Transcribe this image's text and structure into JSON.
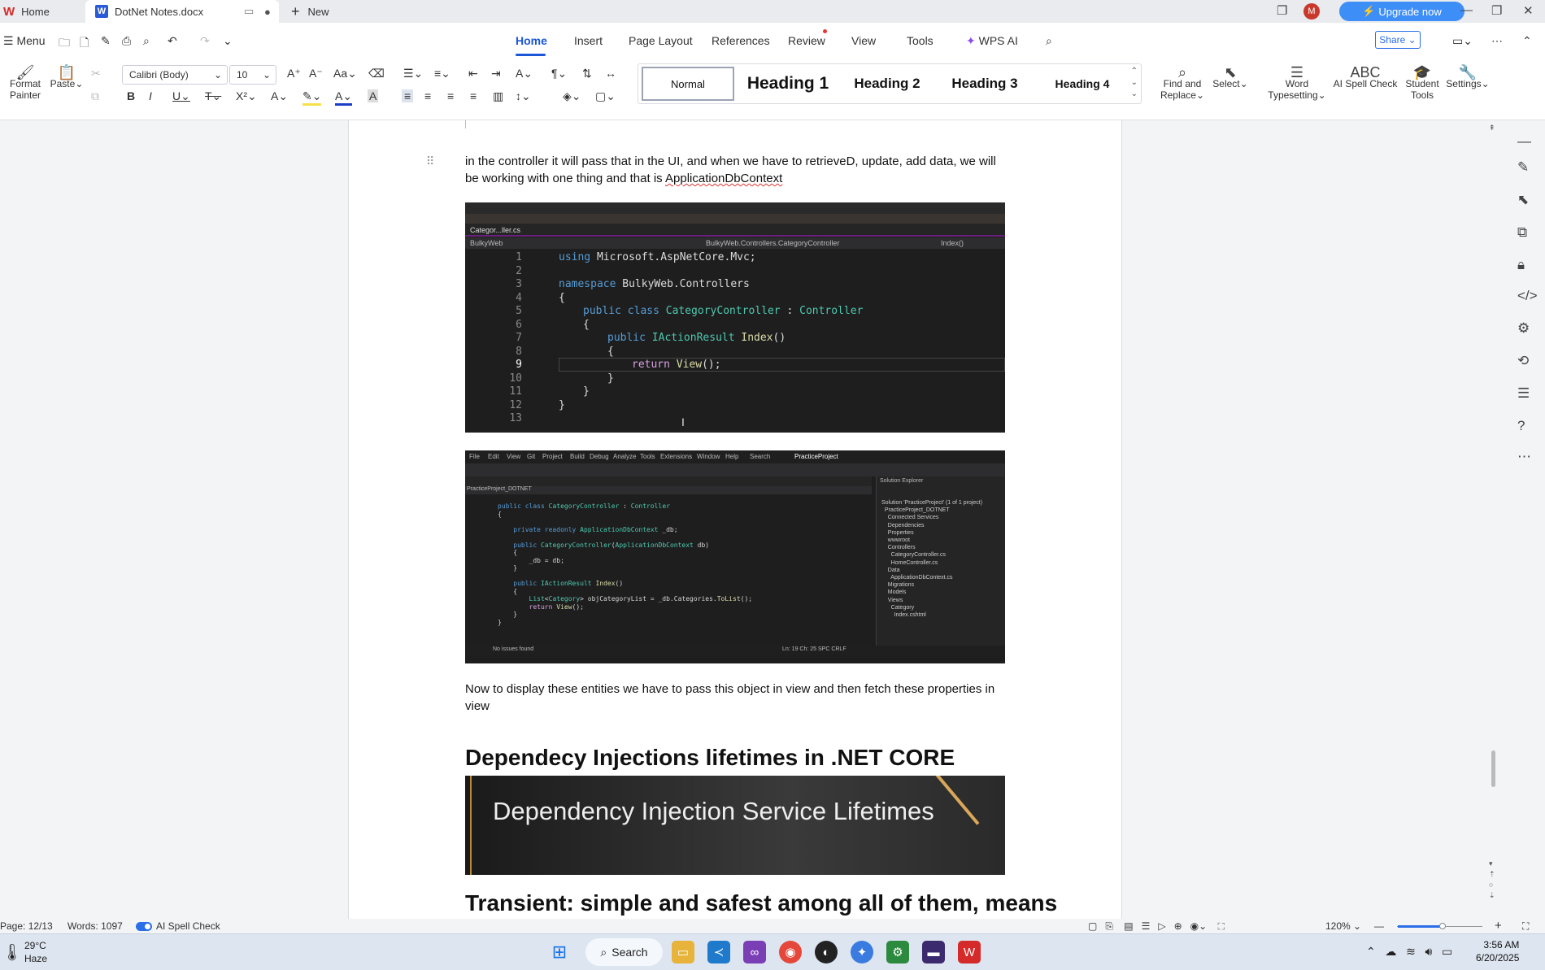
{
  "tabs": {
    "home": "Home",
    "doc": "DotNet Notes.docx",
    "new": "New"
  },
  "titlebar": {
    "upgrade": "Upgrade now",
    "avatar": "M"
  },
  "menu": {
    "menu": "Menu",
    "items": [
      "Home",
      "Insert",
      "Page Layout",
      "References",
      "Review",
      "View",
      "Tools",
      "WPS AI"
    ],
    "share": "Share"
  },
  "ribbon": {
    "format_painter": "Format Painter",
    "paste": "Paste",
    "font": "Calibri (Body)",
    "size": "10",
    "find_replace": "Find and Replace",
    "select": "Select",
    "word_typesetting": "Word Typesetting",
    "ai_spell": "AI Spell Check",
    "student_tools": "Student Tools",
    "settings": "Settings"
  },
  "styles": {
    "normal": "Normal",
    "h1": "Heading 1",
    "h2": "Heading 2",
    "h3": "Heading 3",
    "h4": "Heading 4"
  },
  "doc": {
    "p1a": "in the controller it will pass that in the UI, and when we have to retrieveD, update, add data, we will be working with one thing and that is ",
    "p1b": "ApplicationDbContext",
    "p2": "Now to display these entities we have to pass this object in view and then fetch these properties in view",
    "h1": "Dependecy Injections lifetimes in .NET CORE",
    "img3_title": "Dependency Injection Service Lifetimes",
    "h2": "Transient:  simple and safest among all of them, means"
  },
  "img1": {
    "tab": "Categor...ller.cs",
    "project": "BulkyWeb",
    "path": "BulkyWeb.Controllers.CategoryController",
    "member": "Index()",
    "lines": [
      "1",
      "2",
      "3",
      "4",
      "5",
      "6",
      "7",
      "8",
      "9",
      "10",
      "11",
      "12",
      "13"
    ]
  },
  "img2": {
    "menu": [
      "File",
      "Edit",
      "View",
      "Git",
      "Project",
      "Build",
      "Debug",
      "Analyze",
      "Tools",
      "Extensions",
      "Window",
      "Help",
      "Search",
      "PracticeProject"
    ],
    "solution": "Solution Explorer",
    "project": "PracticeProject_DOTNET",
    "status": "No issues found",
    "pos": "Ln: 19   Ch: 25   SPC   CRLF"
  },
  "status": {
    "page": "Page: 12/13",
    "words": "Words: 1097",
    "spell": "AI Spell Check",
    "zoom": "120%"
  },
  "taskbar": {
    "temp": "29°C",
    "weather": "Haze",
    "search": "Search",
    "time": "3:56 AM",
    "date": "6/20/2025"
  }
}
